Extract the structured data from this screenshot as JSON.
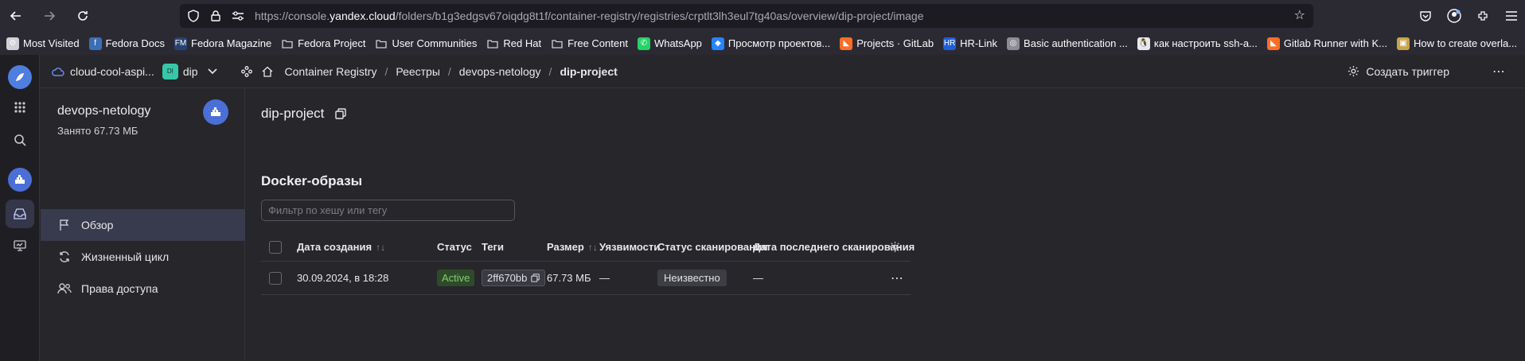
{
  "browser": {
    "url_prefix": "https://console.",
    "url_domain": "yandex.cloud",
    "url_path": "/folders/b1g3edgsv67oiqdg8t1f/container-registry/registries/crptlt3lh3eul7tg40as/overview/dip-project/image"
  },
  "bookmarks": [
    {
      "label": "Most Visited",
      "icon": "gear-icon",
      "color": "#d0d0d6"
    },
    {
      "label": "Fedora Docs",
      "icon": "fedora-icon",
      "color": "#3c6eb4"
    },
    {
      "label": "Fedora Magazine",
      "icon": "fm-icon",
      "color": "#294172"
    },
    {
      "label": "Fedora Project",
      "icon": "folder-icon",
      "color": "#d0d0d6"
    },
    {
      "label": "User Communities",
      "icon": "folder-icon",
      "color": "#d0d0d6"
    },
    {
      "label": "Red Hat",
      "icon": "folder-icon",
      "color": "#d0d0d6"
    },
    {
      "label": "Free Content",
      "icon": "folder-icon",
      "color": "#d0d0d6"
    },
    {
      "label": "WhatsApp",
      "icon": "whatsapp-icon",
      "color": "#25d366"
    },
    {
      "label": "Просмотр проектов...",
      "icon": "jira-icon",
      "color": "#2684ff"
    },
    {
      "label": "Projects · GitLab",
      "icon": "gitlab-icon",
      "color": "#fc6d26"
    },
    {
      "label": "HR-Link",
      "icon": "hr-icon",
      "color": "#1f5fd6"
    },
    {
      "label": "Basic authentication ...",
      "icon": "globe-icon",
      "color": "#8c8c95"
    },
    {
      "label": "как настроить ssh-а...",
      "icon": "linux-icon",
      "color": "#e8e8ea"
    },
    {
      "label": "Gitlab Runner with K...",
      "icon": "gitlab-icon",
      "color": "#fc6d26"
    },
    {
      "label": "How to create overla...",
      "icon": "image-icon",
      "color": "#c9a34a"
    }
  ],
  "topbar": {
    "cloud": "cloud-cool-aspi...",
    "folder_badge": "DI",
    "folder": "dip",
    "crumbs": [
      "Container Registry",
      "Реестры",
      "devops-netology",
      "dip-project"
    ],
    "trigger_label": "Создать триггер"
  },
  "sidebar": {
    "title": "devops-netology",
    "subtitle": "Занято 67.73 МБ",
    "items": [
      {
        "label": "Обзор",
        "active": true
      },
      {
        "label": "Жизненный цикл",
        "active": false
      },
      {
        "label": "Права доступа",
        "active": false
      }
    ]
  },
  "main": {
    "title": "dip-project",
    "section": "Docker-образы",
    "filter_placeholder": "Фильтр по хешу или тегу",
    "columns": {
      "created": "Дата создания",
      "status": "Статус",
      "tags": "Теги",
      "size": "Размер",
      "vuln": "Уязвимости",
      "scan_status": "Статус сканирования",
      "scan_date": "Дата последнего сканирования"
    },
    "rows": [
      {
        "created": "30.09.2024, в 18:28",
        "status": "Active",
        "tag": "2ff670bb",
        "size": "67.73 МБ",
        "vuln": "—",
        "scan_status": "Неизвестно",
        "scan_date": "—"
      }
    ]
  }
}
